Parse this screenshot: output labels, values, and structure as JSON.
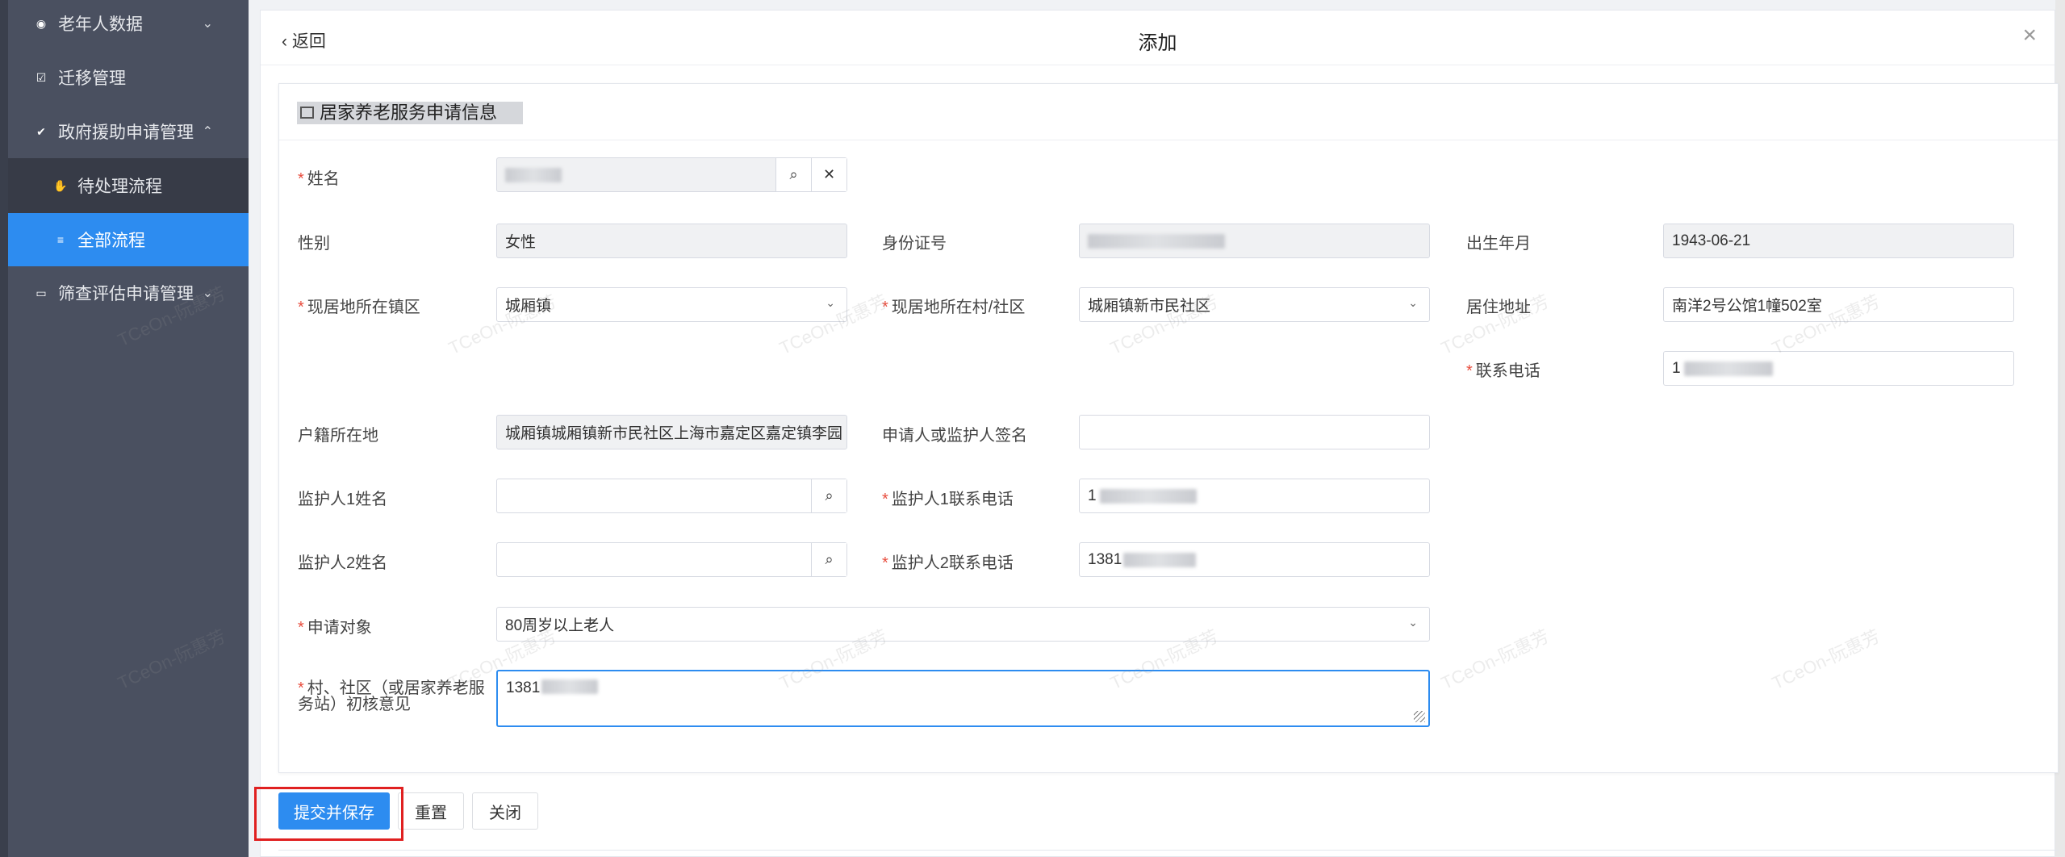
{
  "sidebar": {
    "items": [
      {
        "label": "老年人数据",
        "icon": "elderly-icon",
        "chevron": "⌄"
      },
      {
        "label": "迁移管理",
        "icon": "migrate-icon"
      },
      {
        "label": "政府援助申请管理",
        "icon": "check-circle-icon",
        "chevron": "⌃"
      },
      {
        "label": "待处理流程",
        "icon": "hand-icon"
      },
      {
        "label": "全部流程",
        "icon": "filter-icon"
      },
      {
        "label": "筛查评估申请管理",
        "icon": "card-icon",
        "chevron": "⌄"
      }
    ]
  },
  "header": {
    "back": "返回",
    "title": "添加",
    "close": "×"
  },
  "section": {
    "title": "居家养老服务申请信息"
  },
  "form": {
    "name": {
      "label": "姓名"
    },
    "gender": {
      "label": "性别",
      "value": "女性"
    },
    "id_number": {
      "label": "身份证号"
    },
    "birth": {
      "label": "出生年月",
      "value": "1943-06-21"
    },
    "town": {
      "label": "现居地所在镇区",
      "value": "城厢镇"
    },
    "community": {
      "label": "现居地所在村/社区",
      "value": "城厢镇新市民社区"
    },
    "address": {
      "label": "居住地址",
      "value": "南洋2号公馆1幢502室"
    },
    "phone": {
      "label": "联系电话",
      "value_prefix": "1"
    },
    "household": {
      "label": "户籍所在地",
      "value": "城厢镇城厢镇新市民社区上海市嘉定区嘉定镇李园"
    },
    "signature": {
      "label": "申请人或监护人签名",
      "value": ""
    },
    "guardian1_name": {
      "label": "监护人1姓名",
      "value": ""
    },
    "guardian1_phone": {
      "label": "监护人1联系电话",
      "value_prefix": "1"
    },
    "guardian2_name": {
      "label": "监护人2姓名",
      "value": ""
    },
    "guardian2_phone": {
      "label": "监护人2联系电话",
      "value_prefix": "1381"
    },
    "target": {
      "label": "申请对象",
      "value": "80周岁以上老人"
    },
    "opinion": {
      "label": "村、社区（或居家养老服务站）初核意见",
      "value_prefix": "1381"
    }
  },
  "buttons": {
    "submit": "提交并保存",
    "reset": "重置",
    "close": "关闭"
  },
  "watermark": "TCeOn-阮惠芳",
  "colors": {
    "accent": "#2d8cf0",
    "sidebar": "#4a5060",
    "required": "#e84c3d",
    "highlight": "#e02020"
  }
}
